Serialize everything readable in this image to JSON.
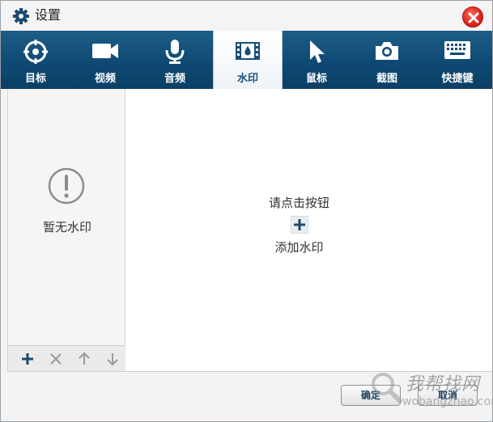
{
  "window": {
    "title": "设置",
    "close_icon": "close-icon"
  },
  "tabs": [
    {
      "label": "目标",
      "icon": "target-icon",
      "active": false
    },
    {
      "label": "视频",
      "icon": "video-camera-icon",
      "active": false
    },
    {
      "label": "音频",
      "icon": "microphone-icon",
      "active": false
    },
    {
      "label": "水印",
      "icon": "watermark-film-icon",
      "active": true
    },
    {
      "label": "鼠标",
      "icon": "mouse-pointer-icon",
      "active": false
    },
    {
      "label": "截图",
      "icon": "camera-icon",
      "active": false
    },
    {
      "label": "快捷键",
      "icon": "keyboard-icon",
      "active": false
    }
  ],
  "left_panel": {
    "empty_text": "暂无水印",
    "toolbar": [
      "add-icon",
      "delete-icon",
      "move-up-icon",
      "move-down-icon"
    ]
  },
  "right_panel": {
    "hint_line1": "请点击按钮",
    "hint_line2": "添加水印"
  },
  "footer": {
    "ok_label": "确定",
    "cancel_label": "取消"
  },
  "overlay_watermark": {
    "brand": "我帮找网",
    "url": "wobangzhao.com"
  },
  "colors": {
    "tabbar": "#0f4a74",
    "active_tab_text": "#1a4f78",
    "close_button": "#e0261d"
  }
}
